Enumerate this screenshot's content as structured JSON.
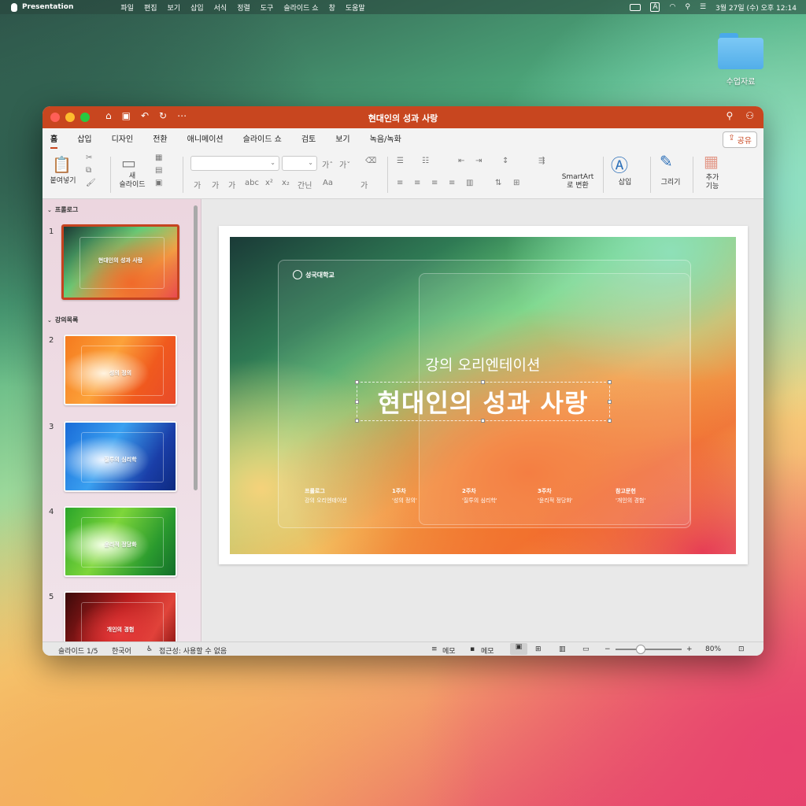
{
  "menubar": {
    "app": "Presentation",
    "items": [
      "파일",
      "편집",
      "보기",
      "삽입",
      "서식",
      "정렬",
      "도구",
      "슬라이드 쇼",
      "창",
      "도움말"
    ],
    "clock": "3월 27일 (수) 오후 12:14",
    "input": "A"
  },
  "desktop": {
    "folder": "수업자료"
  },
  "window": {
    "title": "현대인의 성과 사랑"
  },
  "tabs": [
    "홈",
    "삽입",
    "디자인",
    "전환",
    "애니메이션",
    "슬라이드 쇼",
    "검토",
    "보기",
    "녹음/녹화"
  ],
  "share_label": "공유",
  "ribbon": {
    "paste": "붙여넣기",
    "new_slide_1": "새",
    "new_slide_2": "슬라이드",
    "smartart_1": "SmartArt",
    "smartart_2": "로 변환",
    "insert": "삽입",
    "draw": "그리기",
    "addins_1": "추가",
    "addins_2": "기능",
    "font_grow": "가ˆ",
    "font_shrink": "가ˇ",
    "b": "가",
    "i": "가",
    "u": "가",
    "s": "abc",
    "sup": "x²",
    "sub": "x₂",
    "spacing": "간닌",
    "case": "Aa",
    "clear": "가"
  },
  "sidebar": {
    "section1": "프롤로그",
    "section2": "강의목록",
    "slides": [
      {
        "num": "1",
        "title": "현대인의 성과 사랑"
      },
      {
        "num": "2",
        "title": "성의 정의"
      },
      {
        "num": "3",
        "title": "질투의 심리학"
      },
      {
        "num": "4",
        "title": "윤리적 정당화"
      },
      {
        "num": "5",
        "title": "개인의 경험"
      }
    ]
  },
  "slide": {
    "logo": "성국대학교",
    "subtitle": "강의 오리엔테이션",
    "title": "현대인의 성과 사랑",
    "agenda": [
      {
        "h": "프롤로그",
        "t": "강의 오리엔테이션"
      },
      {
        "h": "1주차",
        "t": "'성의 정의'"
      },
      {
        "h": "2주차",
        "t": "'질투의 심리학'"
      },
      {
        "h": "3주차",
        "t": "'윤리적 정당화'"
      },
      {
        "h": "참고문헌",
        "t": "'개인의 경험'"
      }
    ]
  },
  "status": {
    "slide": "슬라이드 1/5",
    "lang": "한국어",
    "access": "접근성: 사용할 수 없음",
    "notes": "메모",
    "comments": "메모",
    "zoom": "80%",
    "minus": "−",
    "plus": "+"
  }
}
